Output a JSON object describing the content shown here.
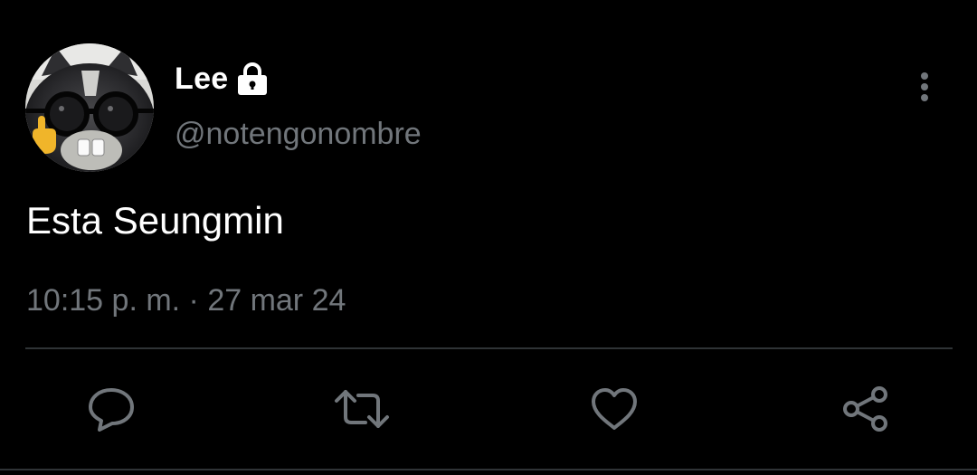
{
  "author": {
    "display_name": "Lee",
    "handle": "@notengonombre",
    "protected_icon": "lock-icon",
    "avatar_icon": "cat-with-glasses-avatar"
  },
  "tweet": {
    "text": "Esta Seungmin",
    "timestamp": "10:15 p. m. · 27 mar 24"
  },
  "menu_icon": "more-vertical-icon",
  "actions": [
    {
      "name": "reply",
      "icon": "reply-icon"
    },
    {
      "name": "retweet",
      "icon": "retweet-icon"
    },
    {
      "name": "like",
      "icon": "heart-icon"
    },
    {
      "name": "share",
      "icon": "share-icon"
    }
  ],
  "colors": {
    "background": "#000000",
    "primary_text": "#ffffff",
    "secondary_text": "#71767b",
    "divider": "#2f3336"
  }
}
